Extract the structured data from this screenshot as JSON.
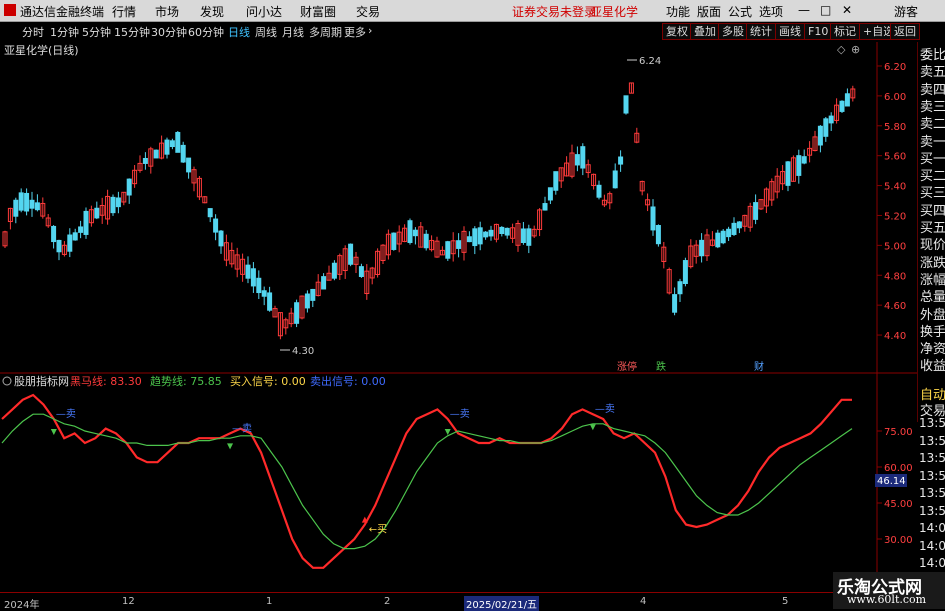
{
  "topbar": {
    "app_title": "通达信金融终端",
    "menus": [
      "行情",
      "市场",
      "发现",
      "问小达",
      "财富圈",
      "交易"
    ],
    "notice": "证券交易未登录",
    "stock_name": "亚星化学",
    "right_menus": [
      "功能",
      "版面",
      "公式",
      "选项"
    ],
    "guest": "游客"
  },
  "timeframes": {
    "items": [
      "分时",
      "1分钟",
      "5分钟",
      "15分钟",
      "30分钟",
      "60分钟",
      "日线",
      "周线",
      "月线",
      "多周期",
      "更多"
    ],
    "active": "日线",
    "buttons": [
      "复权",
      "叠加",
      "多股",
      "统计",
      "画线",
      "F10",
      "标记",
      "+自选",
      "返回"
    ]
  },
  "main_chart": {
    "title": "亚星化学(日线)",
    "y_ticks": [
      "6.20",
      "6.00",
      "5.80",
      "5.60",
      "5.40",
      "5.20",
      "5.00",
      "4.80",
      "4.60",
      "4.40"
    ],
    "high_label": "6.24",
    "low_label": "4.30",
    "markers": [
      "涨停",
      "跌",
      "财"
    ]
  },
  "right_panel": {
    "labels": [
      "委比",
      "卖五",
      "卖四",
      "卖三",
      "卖二",
      "卖一",
      "买一",
      "买二",
      "买三",
      "买四",
      "买五",
      "现价",
      "涨跌",
      "涨幅",
      "总量",
      "外盘",
      "换手",
      "净资",
      "收益"
    ],
    "bottom": [
      "自动",
      "交易"
    ]
  },
  "indicator": {
    "name": "股朋指标网",
    "legend": [
      {
        "label": "黑马线:",
        "value": "83.30",
        "color": "#ff3b3b"
      },
      {
        "label": "趋势线:",
        "value": "75.85",
        "color": "#4cc44c"
      },
      {
        "label": "买入信号:",
        "value": "0.00",
        "color": "#ffd84a"
      },
      {
        "label": "卖出信号:",
        "value": "0.00",
        "color": "#3f6bff"
      }
    ],
    "y_ticks": [
      "75.00",
      "60.00",
      "45.00",
      "30.00",
      "15.00"
    ],
    "current_value": "46.14",
    "sell_label": "卖",
    "buy_label": "买"
  },
  "time_column": [
    "13:58",
    "13:58",
    "13:58",
    "13:59",
    "13:59",
    "13:59",
    "14:00",
    "14:00",
    "14:00"
  ],
  "x_axis": {
    "labels": [
      "2024年",
      "12",
      "1",
      "2",
      "4",
      "5"
    ],
    "highlight": "2025/02/21/五"
  },
  "watermark": {
    "title": "乐淘公式网",
    "url": "www.60lt.com"
  },
  "colors": {
    "up": "#ff3b3b",
    "down": "#54d6f0",
    "bg": "#000000"
  },
  "chart_data": [
    {
      "type": "candlestick",
      "title": "亚星化学(日线)",
      "y_range": [
        4.3,
        6.24
      ],
      "annotations": {
        "high": 6.24,
        "low": 4.3
      }
    },
    {
      "type": "line",
      "y_range": [
        15,
        90
      ],
      "series": [
        {
          "name": "黑马线",
          "values": [
            80,
            84,
            88,
            90,
            86,
            80,
            72,
            74,
            70,
            72,
            76,
            74,
            70,
            64,
            62,
            62,
            66,
            70,
            70,
            72,
            72,
            72,
            74,
            76,
            74,
            66,
            54,
            42,
            30,
            22,
            18,
            18,
            22,
            26,
            30,
            36,
            44,
            54,
            64,
            74,
            80,
            82,
            84,
            80,
            74,
            72,
            70,
            70,
            72,
            70,
            70,
            70,
            70,
            72,
            76,
            82,
            84,
            82,
            80,
            74,
            72,
            74,
            70,
            66,
            56,
            42,
            36,
            35,
            36,
            38,
            40,
            44,
            50,
            58,
            64,
            68,
            70,
            72,
            74,
            78,
            83,
            88,
            88
          ]
        },
        {
          "name": "趋势线",
          "values": [
            70,
            75,
            79,
            82,
            82,
            80,
            78,
            77,
            75,
            74,
            73,
            72,
            70,
            70,
            69,
            69,
            69,
            70,
            70,
            71,
            71,
            72,
            72,
            73,
            73,
            72,
            66,
            60,
            52,
            44,
            38,
            32,
            28,
            26,
            26,
            27,
            30,
            35,
            42,
            50,
            58,
            64,
            70,
            73,
            75,
            74,
            73,
            72,
            71,
            71,
            70,
            70,
            70,
            71,
            73,
            75,
            77,
            78,
            78,
            76,
            75,
            74,
            73,
            70,
            66,
            60,
            54,
            48,
            44,
            41,
            40,
            40,
            42,
            45,
            49,
            53,
            57,
            61,
            64,
            67,
            70,
            73,
            76
          ]
        }
      ]
    }
  ]
}
